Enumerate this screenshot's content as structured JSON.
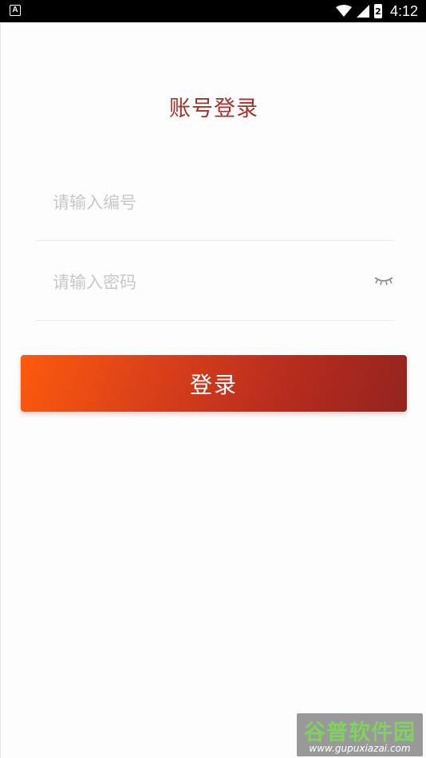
{
  "status_bar": {
    "notification_icon": "A",
    "time": "4:12",
    "battery_level": "2"
  },
  "page": {
    "title": "账号登录"
  },
  "form": {
    "account_placeholder": "请输入编号",
    "account_value": "",
    "password_placeholder": "请输入密码",
    "password_value": "",
    "login_label": "登录"
  },
  "colors": {
    "title": "#a5312a",
    "button_gradient_start": "#fd5a0c",
    "button_gradient_end": "#93241f"
  },
  "watermark": {
    "title": "谷普软件园",
    "url": "www.gupuxiazai.com"
  }
}
